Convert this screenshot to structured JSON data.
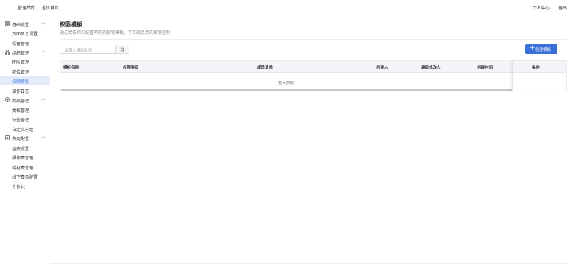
{
  "topbar": {
    "admin": "管理后台",
    "back_home": "返回首页",
    "personal_center": "个人中心",
    "logout": "退出"
  },
  "sidebar": {
    "groups": [
      {
        "label": "基础设置",
        "icon": "grid-icon",
        "items": [
          "页面显示设置",
          "视窗管理"
        ]
      },
      {
        "label": "组织管理",
        "icon": "org-icon",
        "items": [
          "团队管理",
          "岗位管理",
          "权限模板",
          "操作日志"
        ]
      },
      {
        "label": "商品管理",
        "icon": "box-icon",
        "items": [
          "类权管理",
          "标签管理",
          "自定义分组"
        ]
      },
      {
        "label": "费用配置",
        "icon": "fee-icon",
        "items": [
          "运费设置",
          "操作费管理",
          "耗材费管理",
          "线下费用配置",
          "个性化"
        ]
      }
    ],
    "active_item": "权限模板"
  },
  "page": {
    "title": "权限模板",
    "description": "通过给各岗位配置不同的权限模板，可实现灵活的权限控制"
  },
  "search": {
    "placeholder": "请输入模板名称"
  },
  "create_button": {
    "label": "创建模板"
  },
  "table": {
    "columns": [
      "模板名称",
      "权限明细",
      "成员清单",
      "创建人",
      "最后修改人",
      "创建时间",
      "操作"
    ],
    "rows": [],
    "empty_text": "暂无数据"
  },
  "colors": {
    "accent": "#3a6fd8",
    "active_bg": "#e3ecfb"
  }
}
